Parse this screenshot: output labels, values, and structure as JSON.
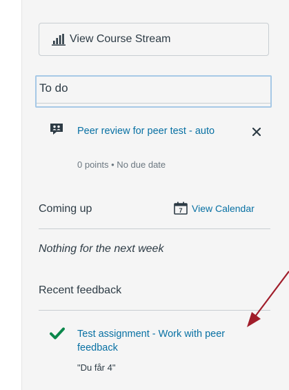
{
  "sidebar": {
    "view_stream_label": "View Course Stream",
    "todo": {
      "title": "To do",
      "items": [
        {
          "title": "Peer review for peer test - auto",
          "meta": "0 points • No due date"
        }
      ]
    },
    "coming_up": {
      "title": "Coming up",
      "calendar_label": "View Calendar",
      "calendar_day": "7",
      "empty_text": "Nothing for the next week"
    },
    "recent_feedback": {
      "title": "Recent feedback",
      "items": [
        {
          "title": "Test assignment - Work with peer feedback",
          "comment": "\"Du får 4\""
        }
      ]
    }
  },
  "colors": {
    "link": "#0770a3",
    "text": "#2d3b45",
    "success": "#0b874b",
    "annotation_arrow": "#a01d2a"
  }
}
